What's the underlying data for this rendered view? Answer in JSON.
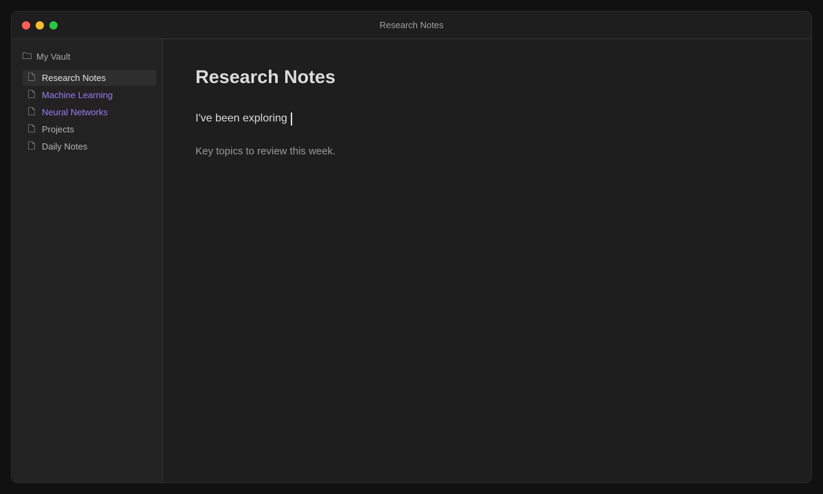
{
  "window": {
    "title": "Research Notes"
  },
  "traffic_lights": {
    "close_color": "#ff5f57",
    "minimize_color": "#febc2e",
    "maximize_color": "#28c840"
  },
  "sidebar": {
    "vault": {
      "icon": "folder-icon",
      "label": "My Vault"
    },
    "items": [
      {
        "label": "Research Notes",
        "icon": "file-icon",
        "state": "active"
      },
      {
        "label": "Machine Learning",
        "icon": "file-icon",
        "state": "linked"
      },
      {
        "label": "Neural Networks",
        "icon": "file-icon",
        "state": "linked"
      },
      {
        "label": "Projects",
        "icon": "file-icon",
        "state": "normal"
      },
      {
        "label": "Daily Notes",
        "icon": "file-icon",
        "state": "normal"
      }
    ]
  },
  "editor": {
    "title": "Research Notes",
    "typing_line": "I've been exploring ",
    "body": "Key topics to review this week."
  },
  "colors": {
    "link_accent": "#9b7bf0",
    "background": "#1e1e1e",
    "sidebar_background": "#222222"
  }
}
